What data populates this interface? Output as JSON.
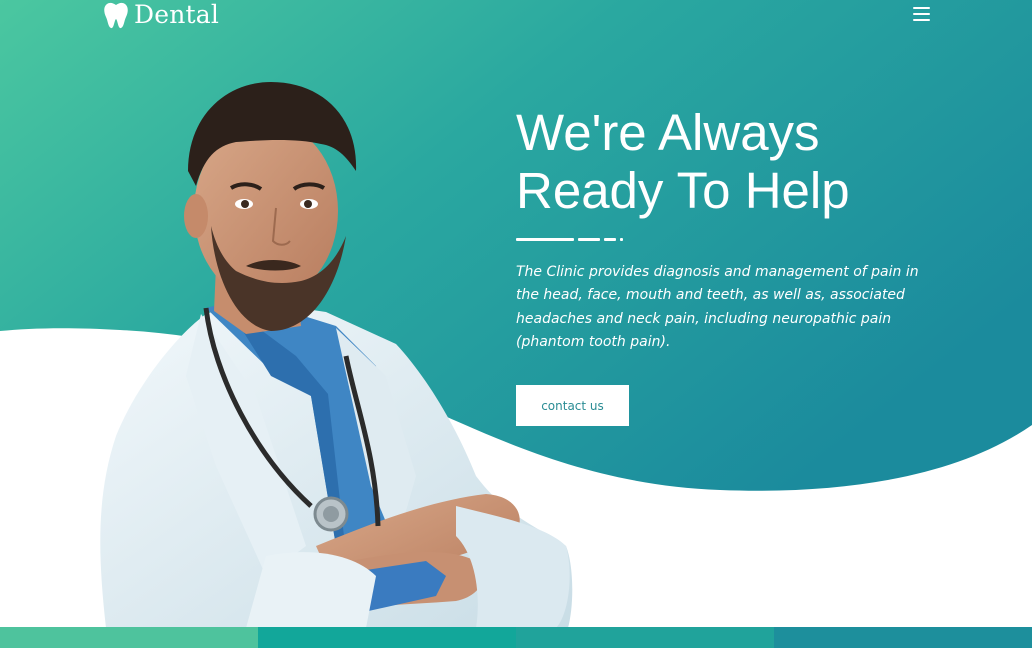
{
  "brand": {
    "name": "Dental",
    "logo_icon": "tooth-icon"
  },
  "nav": {
    "menu_icon": "hamburger-menu-icon"
  },
  "hero": {
    "title_line1": "We're Always",
    "title_line2": "Ready To Help",
    "description": "The Clinic provides diagnosis and management of pain in the head, face, mouth and teeth, as well as, associated headaches and neck pain, including neuropathic pain (phantom tooth pain).",
    "cta_label": "contact us",
    "image_subject": "doctor-photo"
  },
  "colors": {
    "gradient_start": "#4cc69f",
    "gradient_end": "#1e8d9e",
    "button_text": "#2a8c94",
    "strip": [
      "#4ec39d",
      "#12a79a",
      "#20a39b",
      "#1d8f9c"
    ]
  }
}
